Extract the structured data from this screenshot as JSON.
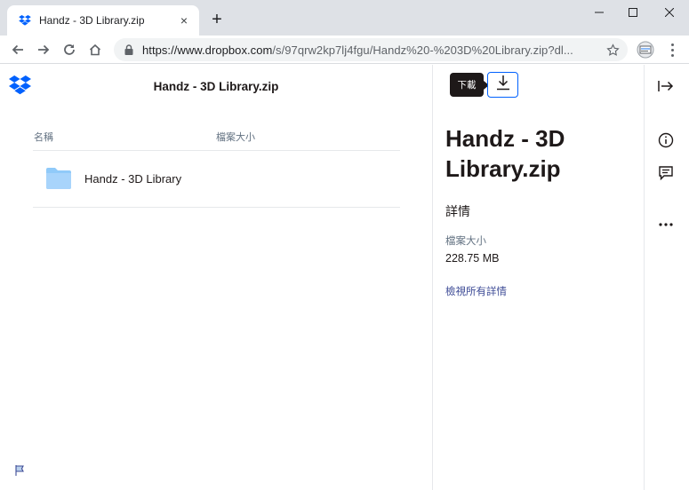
{
  "browser": {
    "tab_title": "Handz - 3D Library.zip",
    "tab_close": "×",
    "new_tab": "+",
    "url_host": "https://www.dropbox.com",
    "url_path": "/s/97qrw2kp7lj4fgu/Handz%20-%203D%20Library.zip?dl..."
  },
  "page": {
    "file_title": "Handz - 3D Library.zip",
    "columns": {
      "name": "名稱",
      "size": "檔案大小"
    },
    "rows": [
      {
        "name": "Handz - 3D Library",
        "size": ""
      }
    ],
    "tooltip": "下載",
    "sidebar": {
      "title": "Handz - 3D Library.zip",
      "details_heading": "詳情",
      "size_label": "檔案大小",
      "size_value": "228.75 MB",
      "view_all_link": "檢視所有詳情"
    }
  },
  "colors": {
    "accent": "#0061fe",
    "folder": "#90caf9",
    "link": "#3d4b96"
  },
  "icons": {
    "dropbox_logo": "dropbox-logo",
    "download": "download-icon",
    "collapse": "collapse-arrow-icon",
    "info": "info-icon",
    "comment": "comment-icon",
    "more": "more-icon",
    "flag": "flag-icon"
  }
}
